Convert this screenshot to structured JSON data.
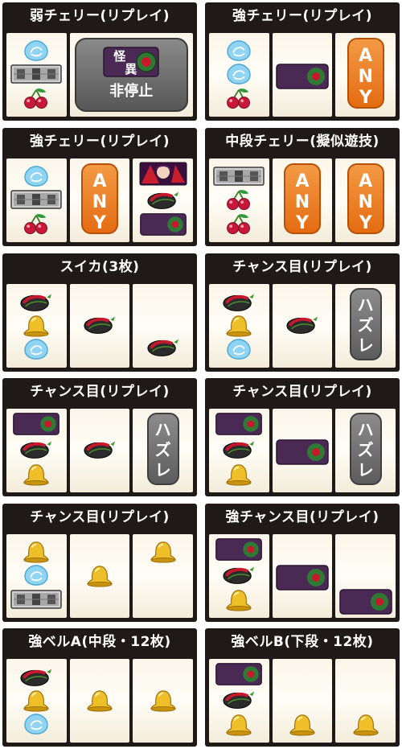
{
  "panels": [
    {
      "title": "弱チェリー(リプレイ)"
    },
    {
      "title": "強チェリー(リプレイ)"
    },
    {
      "title": "強チェリー(リプレイ)"
    },
    {
      "title": "中段チェリー(擬似遊技)"
    },
    {
      "title": "スイカ(3枚)"
    },
    {
      "title": "チャンス目(リプレイ)"
    },
    {
      "title": "チャンス目(リプレイ)"
    },
    {
      "title": "チャンス目(リプレイ)"
    },
    {
      "title": "チャンス目(リプレイ)"
    },
    {
      "title": "強チャンス目(リプレイ)"
    },
    {
      "title": "強ベルA(中段・12枚)"
    },
    {
      "title": "強ベルB(下段・12枚)"
    }
  ],
  "labels": {
    "any_line1": "A",
    "any_line2": "N",
    "any_line3": "Y",
    "hazure_line1": "ハ",
    "hazure_line2": "ズ",
    "hazure_line3": "レ",
    "non_stop": "非停止",
    "emblem_top": "怪",
    "emblem_bottom": "異"
  },
  "colors": {
    "panel_bg": "#1f1a17",
    "any_orange": "#e8761a",
    "hazure_gray": "#6f6f6f",
    "reel_bg": "#fbf6ea"
  }
}
